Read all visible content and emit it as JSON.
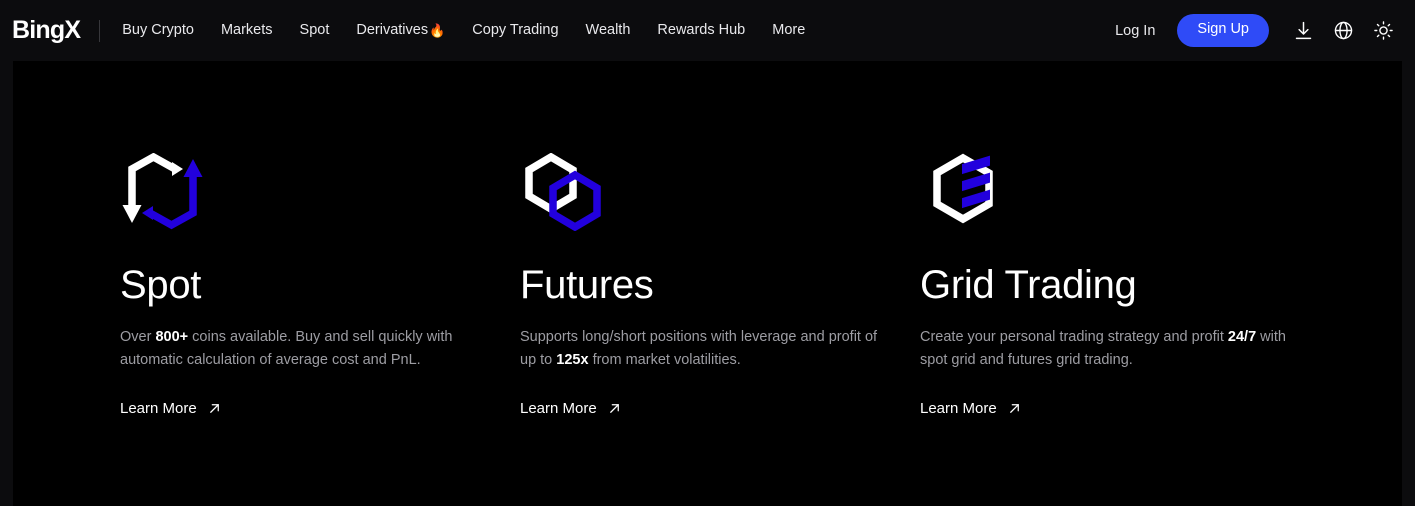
{
  "header": {
    "logo": "BingX",
    "nav_items": [
      {
        "label": "Buy Crypto",
        "badge": ""
      },
      {
        "label": "Markets",
        "badge": ""
      },
      {
        "label": "Spot",
        "badge": ""
      },
      {
        "label": "Derivatives",
        "badge": "🔥"
      },
      {
        "label": "Copy Trading",
        "badge": ""
      },
      {
        "label": "Wealth",
        "badge": ""
      },
      {
        "label": "Rewards Hub",
        "badge": ""
      },
      {
        "label": "More",
        "badge": ""
      }
    ],
    "login_label": "Log In",
    "signup_label": "Sign Up",
    "icons": [
      "download-icon",
      "globe-icon",
      "brightness-icon"
    ]
  },
  "features": [
    {
      "icon": "spot-swap-arrows-icon",
      "title": "Spot",
      "desc_before": "Over ",
      "desc_highlight": "800+",
      "desc_after": " coins available. Buy and sell quickly with automatic calculation of average cost and PnL.",
      "link_label": "Learn More"
    },
    {
      "icon": "futures-interlocking-hexagons-icon",
      "title": "Futures",
      "desc_before": "Supports long/short positions with leverage and profit of up to ",
      "desc_highlight": "125x",
      "desc_after": " from market volatilities.",
      "link_label": "Learn More"
    },
    {
      "icon": "grid-trading-hexagon-bars-icon",
      "title": "Grid Trading",
      "desc_before": "Create your personal trading strategy and profit ",
      "desc_highlight": "24/7",
      "desc_after": " with spot grid and futures grid trading.",
      "link_label": "Learn More"
    }
  ],
  "colors": {
    "accent_blue": "#2f4bf7",
    "icon_blue": "#2200dd",
    "background": "#000000",
    "header_background": "#0c0c0e",
    "text_primary": "#ffffff",
    "text_secondary": "#9d9da3"
  }
}
